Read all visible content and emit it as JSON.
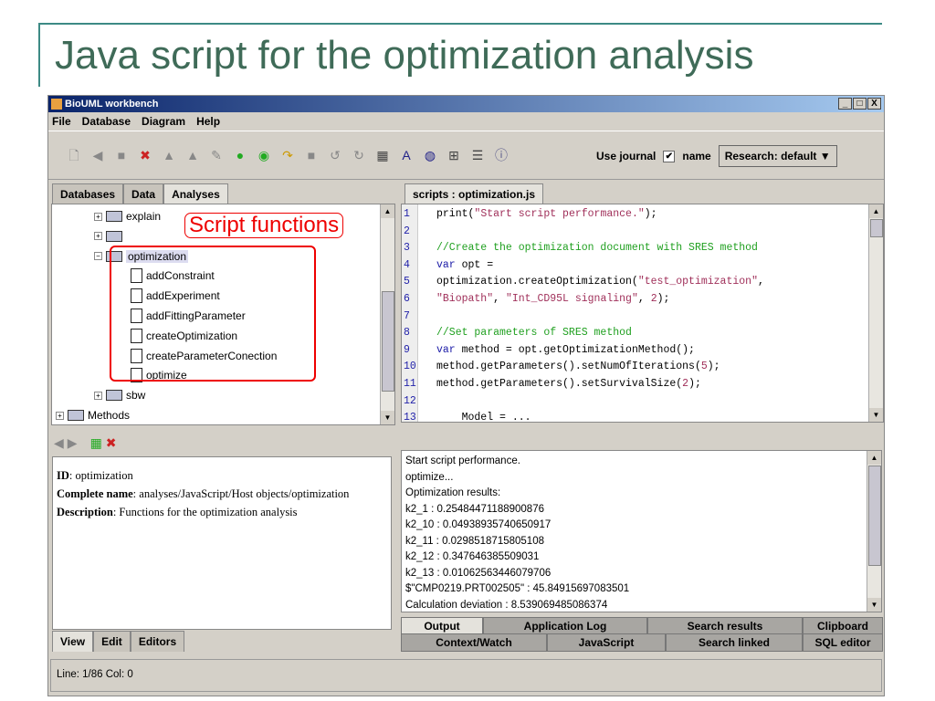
{
  "slide": {
    "title": "Java script for the optimization analysis"
  },
  "window": {
    "title": "BioUML workbench",
    "controls": [
      "_",
      "□",
      "X"
    ]
  },
  "menu": [
    "File",
    "Database",
    "Diagram",
    "Help"
  ],
  "toolbar": {
    "use_journal": "Use journal",
    "checkbox_mark": "✔",
    "name_label": "name",
    "research": "Research: default ▼"
  },
  "left_tabs": [
    "Databases",
    "Data",
    "Analyses"
  ],
  "editor_tab": "scripts : optimization.js",
  "tree": {
    "callout": "Script functions",
    "items": [
      {
        "label": "explain",
        "level": 2,
        "type": "folder",
        "exp": "+"
      },
      {
        "label": "",
        "level": 2,
        "type": "folder",
        "exp": "+"
      },
      {
        "label": "optimization",
        "level": 2,
        "type": "folder",
        "exp": "−",
        "selected": true
      },
      {
        "label": "addConstraint",
        "level": 3,
        "type": "doc"
      },
      {
        "label": "addExperiment",
        "level": 3,
        "type": "doc"
      },
      {
        "label": "addFittingParameter",
        "level": 3,
        "type": "doc"
      },
      {
        "label": "createOptimization",
        "level": 3,
        "type": "doc"
      },
      {
        "label": "createParameterConection",
        "level": 3,
        "type": "doc"
      },
      {
        "label": "optimize",
        "level": 3,
        "type": "doc"
      },
      {
        "label": "sbw",
        "level": 2,
        "type": "folder",
        "exp": "+"
      },
      {
        "label": "Methods",
        "level": 1,
        "type": "folder",
        "exp": "+"
      }
    ]
  },
  "code": [
    [
      [
        "id",
        "print("
      ],
      [
        "str",
        "\"Start script performance.\""
      ],
      [
        "id",
        ");"
      ]
    ],
    [],
    [
      [
        "com",
        "//Create the optimization document with SRES method"
      ]
    ],
    [
      [
        "kw",
        "var"
      ],
      [
        "id",
        " opt ="
      ]
    ],
    [
      [
        "id",
        "optimization.createOptimization("
      ],
      [
        "str",
        "\"test_optimization\""
      ],
      [
        "id",
        ","
      ]
    ],
    [
      [
        "str",
        "\"Biopath\""
      ],
      [
        "id",
        ", "
      ],
      [
        "str",
        "\"Int_CD95L signaling\""
      ],
      [
        "id",
        ", "
      ],
      [
        "num",
        "2"
      ],
      [
        "id",
        ");"
      ]
    ],
    [],
    [
      [
        "com",
        "//Set parameters of SRES method"
      ]
    ],
    [
      [
        "kw",
        "var"
      ],
      [
        "id",
        " method = opt.getOptimizationMethod();"
      ]
    ],
    [
      [
        "id",
        "method.getParameters().setNumOfIterations("
      ],
      [
        "num",
        "5"
      ],
      [
        "id",
        ");"
      ]
    ],
    [
      [
        "id",
        "method.getParameters().setSurvivalSize("
      ],
      [
        "num",
        "2"
      ],
      [
        "id",
        ");"
      ]
    ],
    [],
    [
      [
        "id",
        "    Model = ..."
      ]
    ]
  ],
  "info": {
    "id_label": "ID",
    "id": ": optimization",
    "cn_label": "Complete name",
    "cn": ": analyses/JavaScript/Host objects/optimization",
    "desc_label": "Description",
    "desc": ": Functions for the optimization analysis"
  },
  "bottom_left_tabs": [
    "View",
    "Edit",
    "Editors"
  ],
  "output": [
    "Start script performance.",
    "optimize...",
    "Optimization results:",
    "k2_1 : 0.25484471188900876",
    "k2_10 : 0.04938935740650917",
    "k2_11 : 0.0298518715805108",
    "k2_12 : 0.347646385509031",
    "k2_13 : 0.01062563446079706",
    "$\"CMP0219.PRT002505\" : 45.84915697083501",
    "Calculation deviation : 8.539069485086374"
  ],
  "output_tabs_row1": [
    "Output",
    "Application Log",
    "Search results",
    "Clipboard"
  ],
  "output_tabs_row2": [
    "Context/Watch",
    "JavaScript",
    "Search linked",
    "SQL editor"
  ],
  "status": "Line: 1/86 Col: 0"
}
